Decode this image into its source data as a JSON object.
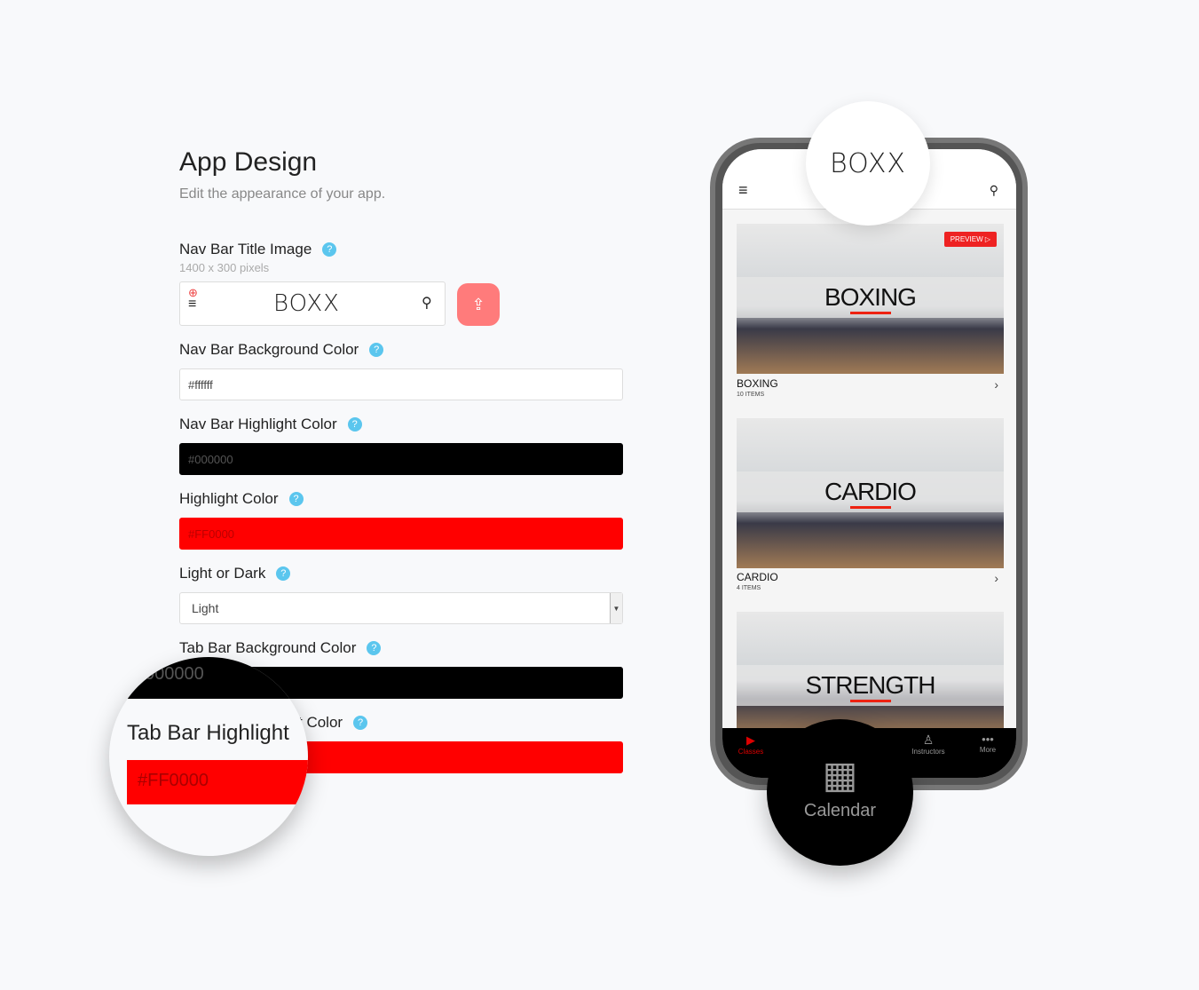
{
  "page": {
    "title": "App Design",
    "subtitle": "Edit the appearance of your app."
  },
  "fields": {
    "nav_title_image": {
      "label": "Nav Bar Title Image",
      "hint": "1400 x 300 pixels",
      "logo": "BOXX"
    },
    "nav_bg": {
      "label": "Nav Bar Background Color",
      "value": "#ffffff"
    },
    "nav_highlight": {
      "label": "Nav Bar Highlight Color",
      "value": "#000000"
    },
    "highlight": {
      "label": "Highlight Color",
      "value": "#FF0000"
    },
    "light_dark": {
      "label": "Light or Dark",
      "value": "Light"
    },
    "tab_bg": {
      "label": "Tab Bar Background Color",
      "value": "#000000"
    },
    "tab_highlight": {
      "label": "Tab Bar Highlight Color",
      "value": "#FF0000"
    }
  },
  "help_icon": "?",
  "magnifier": {
    "label": "Tab Bar Highlight",
    "value": "#FF0000",
    "above_value": "000000",
    "behind_label": "t Color"
  },
  "phone": {
    "logo": "BOXX",
    "preview_label": "PREVIEW",
    "cards": [
      {
        "band": "BOXING",
        "title": "BOXING",
        "count": "10 ITEMS"
      },
      {
        "band": "CARDIO",
        "title": "CARDIO",
        "count": "4 ITEMS"
      },
      {
        "band": "STRENGTH"
      }
    ],
    "tabs": [
      {
        "label": "Classes"
      },
      {
        "label": "Calendar"
      },
      {
        "label": "Instructors"
      },
      {
        "label": "More"
      }
    ]
  },
  "colors": {
    "accent": "#ff0000",
    "upload": "#ff7b7b",
    "help": "#5bc6ee"
  }
}
